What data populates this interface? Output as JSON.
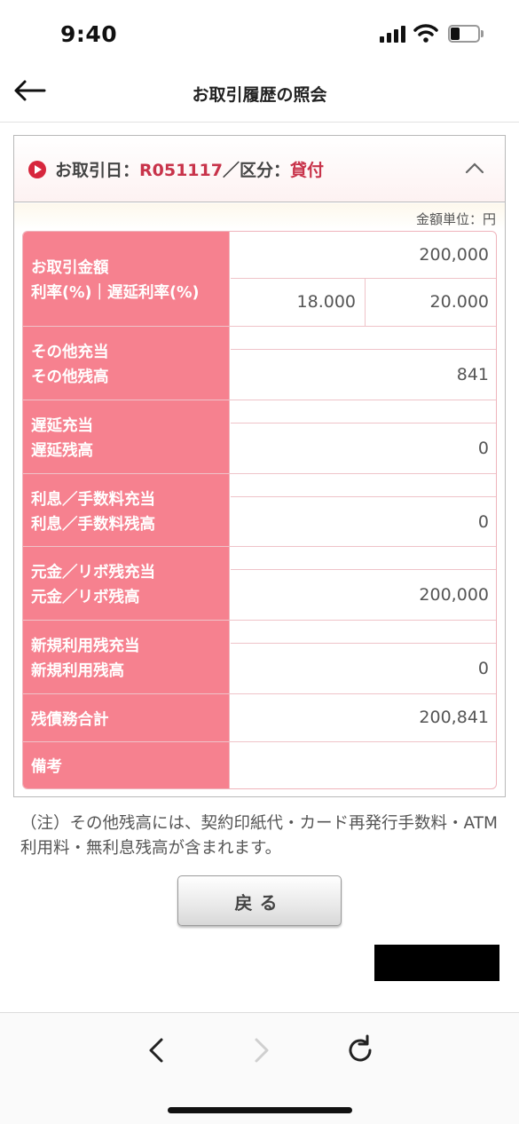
{
  "status_bar": {
    "time": "9:40"
  },
  "header": {
    "title": "お取引履歴の照会"
  },
  "transaction": {
    "date_label": "お取引日：",
    "date_value": "R051117",
    "separator": "／",
    "type_label": "区分：",
    "type_value": "貸付"
  },
  "unit_label": "金額単位：円",
  "table": {
    "amount_label": "お取引金額",
    "rate_label": "利率(%)｜遅延利率(%)",
    "amount_value": "200,000",
    "interest_rate": "18.000",
    "late_rate": "20.000",
    "rows": [
      {
        "label1": "その他充当",
        "label2": "その他残高",
        "value1": "",
        "value2": "841"
      },
      {
        "label1": "遅延充当",
        "label2": "遅延残高",
        "value1": "",
        "value2": "0"
      },
      {
        "label1": "利息／手数料充当",
        "label2": "利息／手数料残高",
        "value1": "",
        "value2": "0"
      },
      {
        "label1": "元金／リボ残充当",
        "label2": "元金／リボ残高",
        "value1": "",
        "value2": "200,000"
      },
      {
        "label1": "新規利用残充当",
        "label2": "新規利用残高",
        "value1": "",
        "value2": "0"
      }
    ],
    "total_label": "残債務合計",
    "total_value": "200,841",
    "remarks_label": "備考",
    "remarks_value": ""
  },
  "note": "（注）その他残高には、契約印紙代・カード再発行手数料・ATM利用料・無利息残高が含まれます。",
  "back_button_label": "戻る",
  "colors": {
    "label_bg": "#f6818f",
    "accent_red": "#c8334a",
    "border_pink": "#efc3c9"
  },
  "icons": {
    "back": "left-arrow-icon",
    "collapse": "chevron-up-icon",
    "browser_back": "chevron-left-icon",
    "browser_forward": "chevron-right-icon",
    "reload": "reload-icon"
  }
}
